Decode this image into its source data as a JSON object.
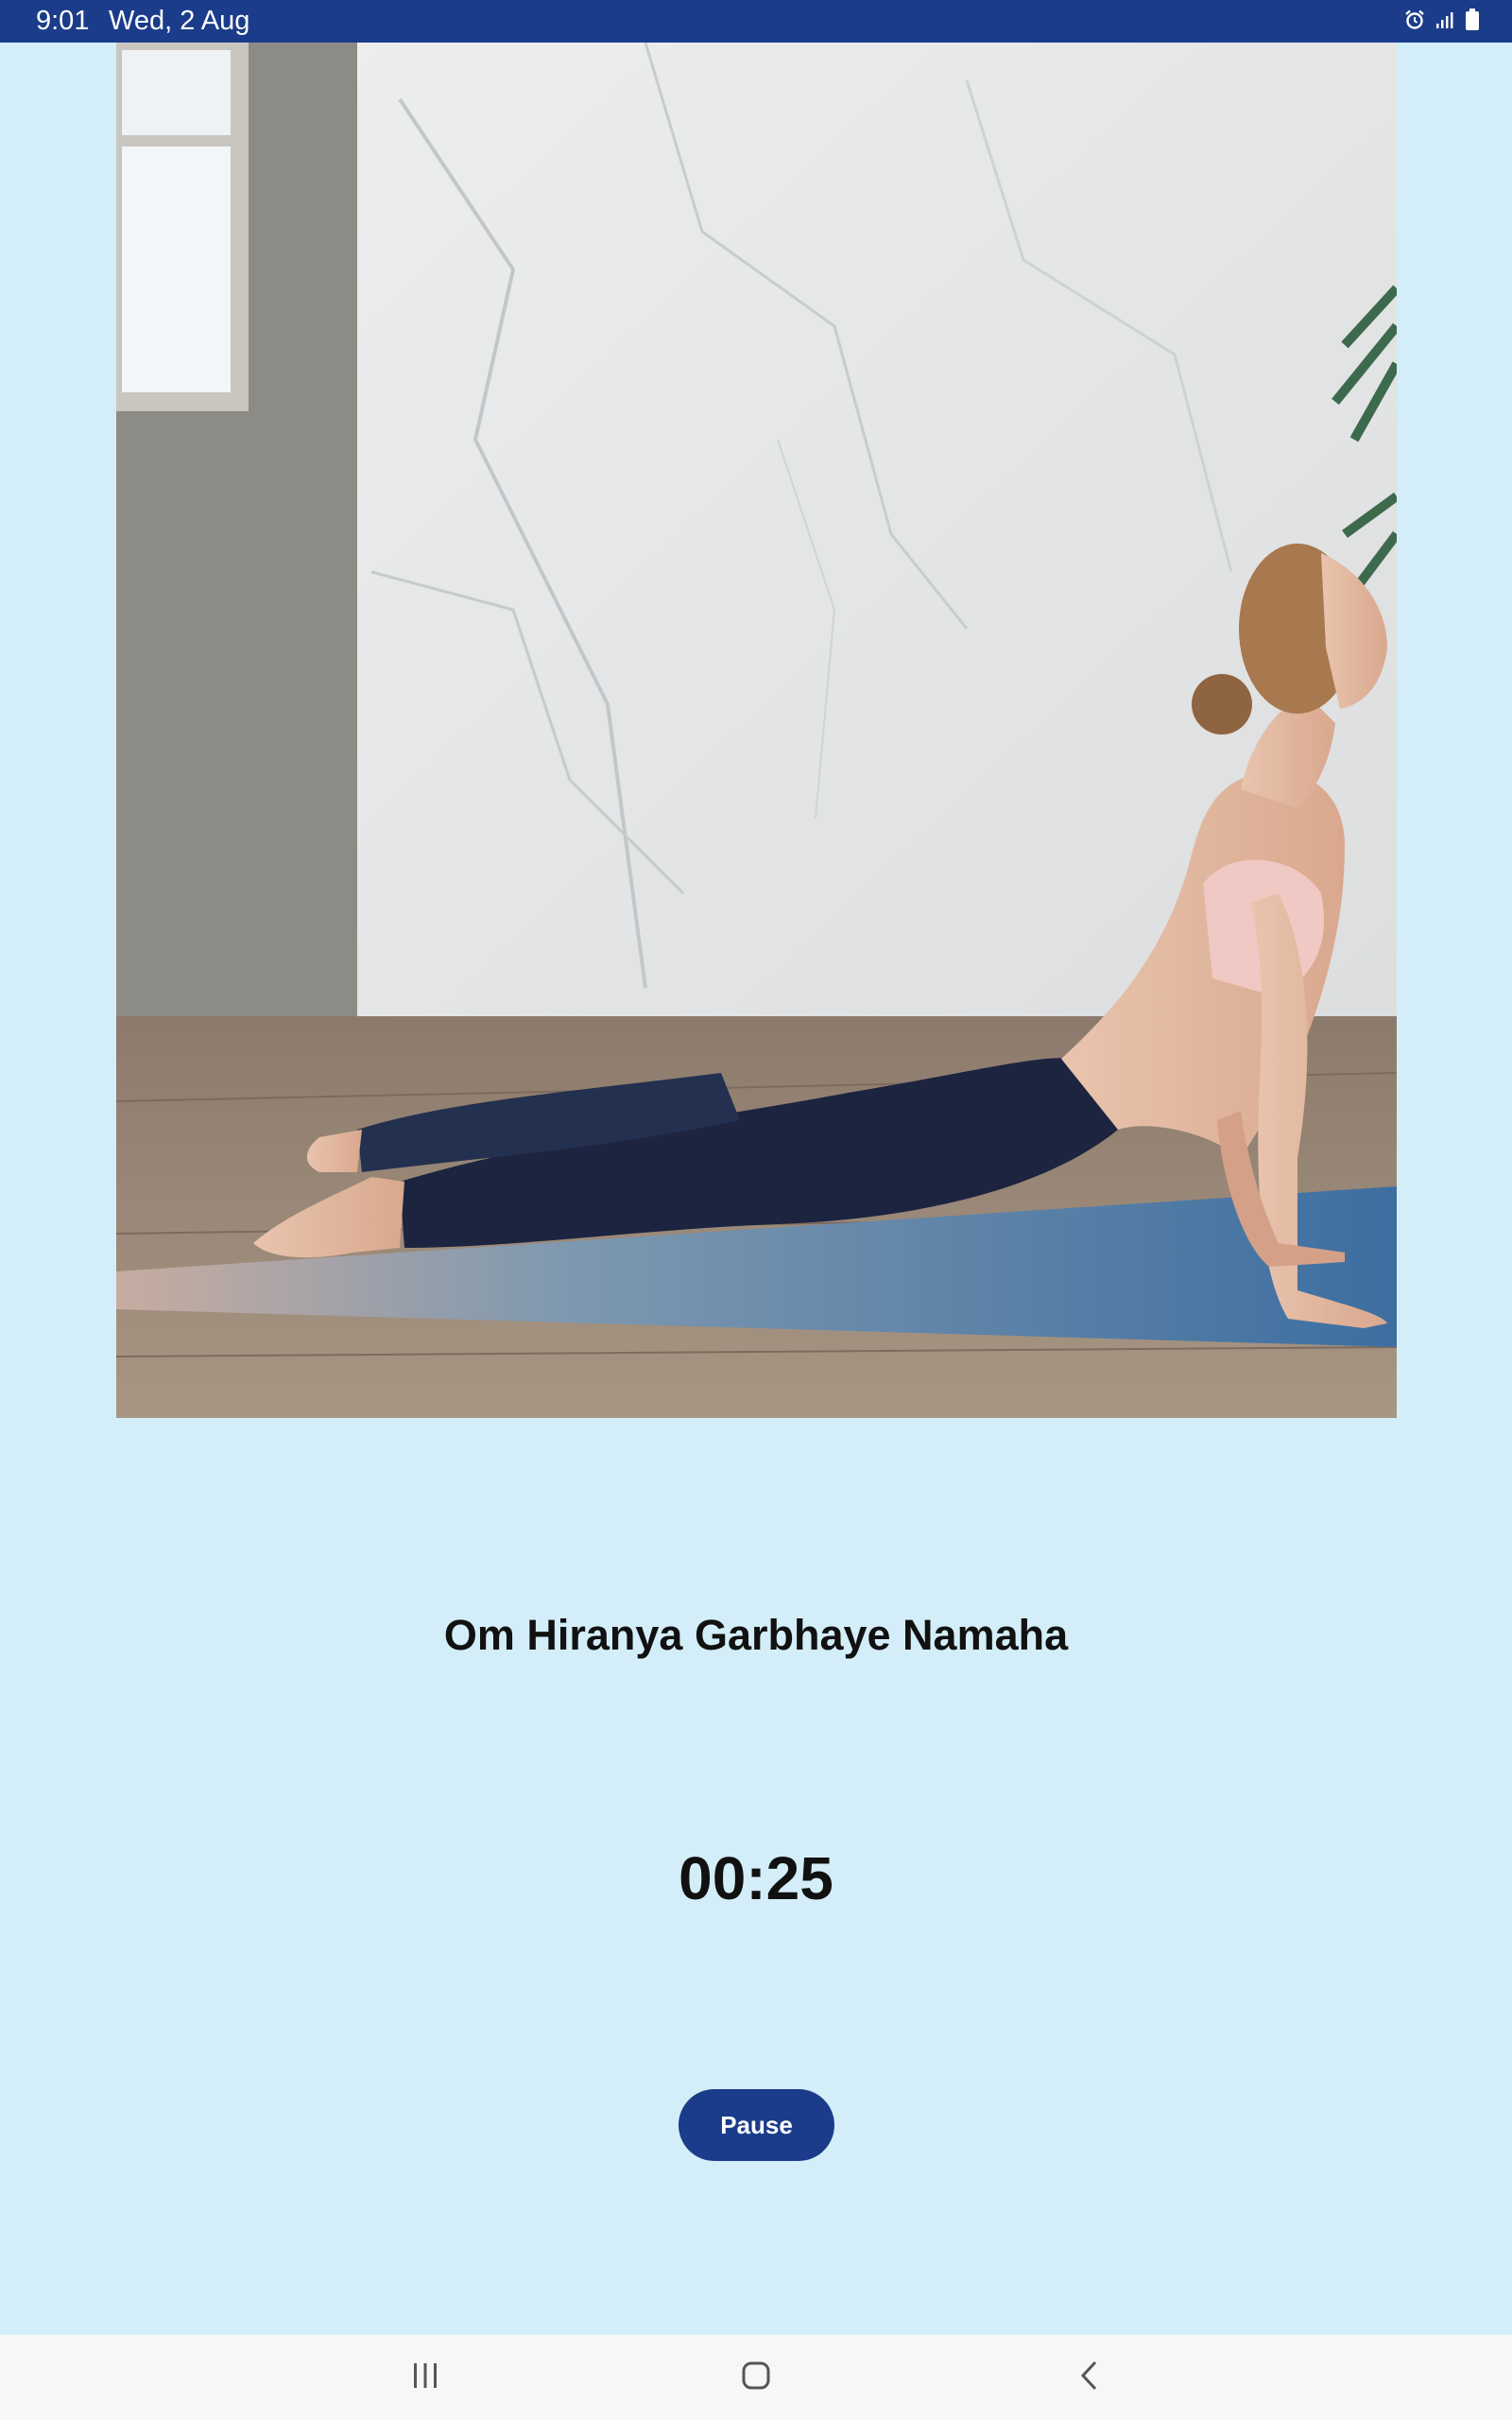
{
  "status_bar": {
    "time": "9:01",
    "date": "Wed, 2 Aug",
    "icons": [
      "alarm-icon",
      "signal-icon",
      "battery-icon"
    ]
  },
  "pose_image": {
    "description_icon": "yoga-cobra-pose-photo"
  },
  "mantra": "Om Hiranya Garbhaye Namaha",
  "timer": "00:25",
  "pause_button": {
    "label": "Pause"
  },
  "nav_bar": {
    "buttons": [
      "recent-apps-icon",
      "home-icon",
      "back-icon"
    ]
  },
  "colors": {
    "background": "#d3eef8",
    "accent": "#1a3c8a",
    "nav_background": "#f6f7f8"
  }
}
